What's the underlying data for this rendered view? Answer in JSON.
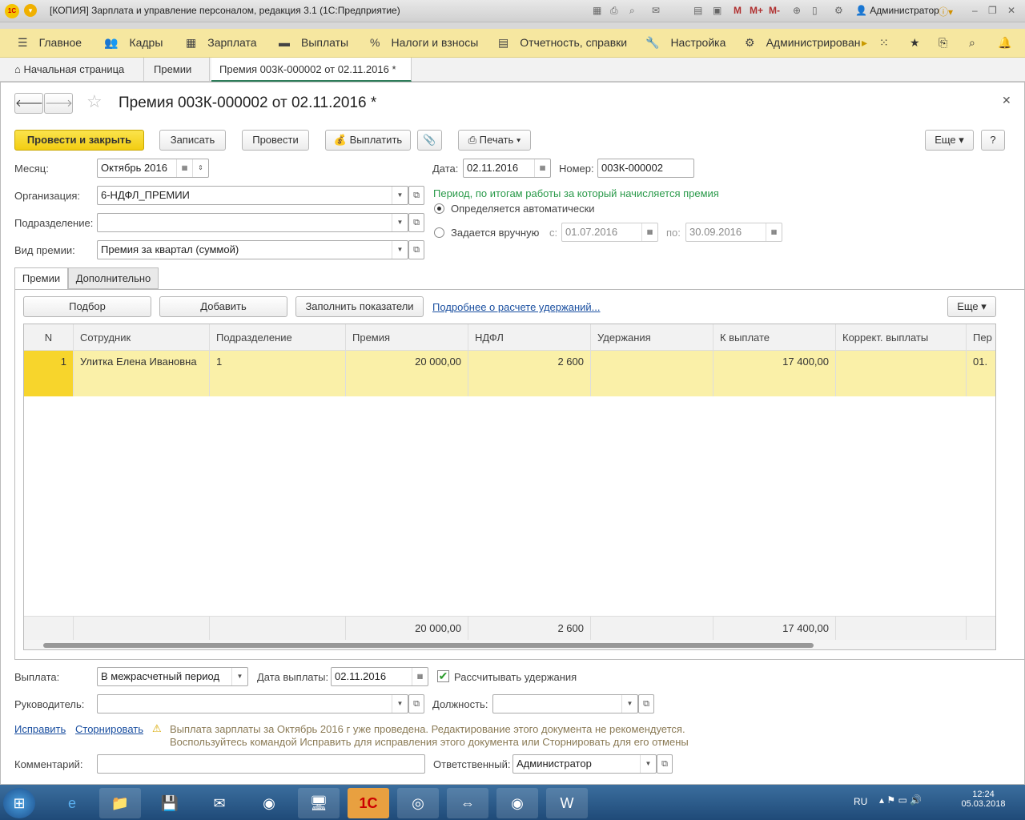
{
  "window": {
    "title": "[КОПИЯ] Зарплата и управление персоналом, редакция 3.1  (1С:Предприятие)",
    "user": "Администратор",
    "m": "M",
    "mplus": "M+",
    "mminus": "M-"
  },
  "menu": [
    "Главное",
    "Кадры",
    "Зарплата",
    "Выплаты",
    "Налоги и взносы",
    "Отчетность, справки",
    "Настройка",
    "Администрирован"
  ],
  "tabs": [
    "Начальная страница",
    "Премии",
    "Премия 003К-000002 от 02.11.2016 *"
  ],
  "doc": {
    "title": "Премия 003К-000002 от 02.11.2016 *"
  },
  "toolbar": {
    "post_close": "Провести и закрыть",
    "save": "Записать",
    "post": "Провести",
    "pay": "Выплатить",
    "print": "Печать",
    "more": "Еще",
    "help": "?"
  },
  "fields": {
    "month_label": "Месяц:",
    "month": "Октябрь 2016",
    "date_label": "Дата:",
    "date": "02.11.2016",
    "number_label": "Номер:",
    "number": "003К-000002",
    "org_label": "Организация:",
    "org": "6-НДФЛ_ПРЕМИИ",
    "dept_label": "Подразделение:",
    "dept": "",
    "kind_label": "Вид премии:",
    "kind": "Премия за квартал (суммой)",
    "period_title": "Период, по итогам работы за который начисляется премия",
    "auto": "Определяется автоматически",
    "manual": "Задается вручную",
    "from_label": "с:",
    "from": "01.07.2016",
    "to_label": "по:",
    "to": "30.09.2016"
  },
  "innertabs": [
    "Премии",
    "Дополнительно"
  ],
  "gridbar": {
    "select": "Подбор",
    "add": "Добавить",
    "fill": "Заполнить показатели",
    "details": "Подробнее о расчете удержаний...",
    "more": "Еще"
  },
  "table": {
    "headers": [
      "N",
      "Сотрудник",
      "Подразделение",
      "Премия",
      "НДФЛ",
      "Удержания",
      "К выплате",
      "Коррект. выплаты",
      "Пер"
    ],
    "rows": [
      [
        "1",
        "Улитка Елена Ивановна",
        "1",
        "20 000,00",
        "2 600",
        "",
        "17 400,00",
        "",
        "01."
      ]
    ],
    "totals": [
      "",
      "",
      "",
      "20 000,00",
      "2 600",
      "",
      "17 400,00",
      "",
      ""
    ]
  },
  "bottom": {
    "pay_label": "Выплата:",
    "pay": "В межрасчетный период",
    "paydate_label": "Дата выплаты:",
    "paydate": "02.11.2016",
    "calc": "Рассчитывать удержания",
    "head_label": "Руководитель:",
    "head": "",
    "pos_label": "Должность:",
    "pos": "",
    "fix": "Исправить",
    "storno": "Сторнировать",
    "warn1": "Выплата зарплаты за Октябрь 2016 г уже проведена. Редактирование этого документа не рекомендуется.",
    "warn2": "Воспользуйтесь командой Исправить для исправления этого документа или Сторнировать для его отмены",
    "comment_label": "Комментарий:",
    "comment": "",
    "resp_label": "Ответственный:",
    "resp": "Администратор"
  },
  "taskbar": {
    "lang": "RU",
    "time": "12:24",
    "date": "05.03.2018"
  }
}
